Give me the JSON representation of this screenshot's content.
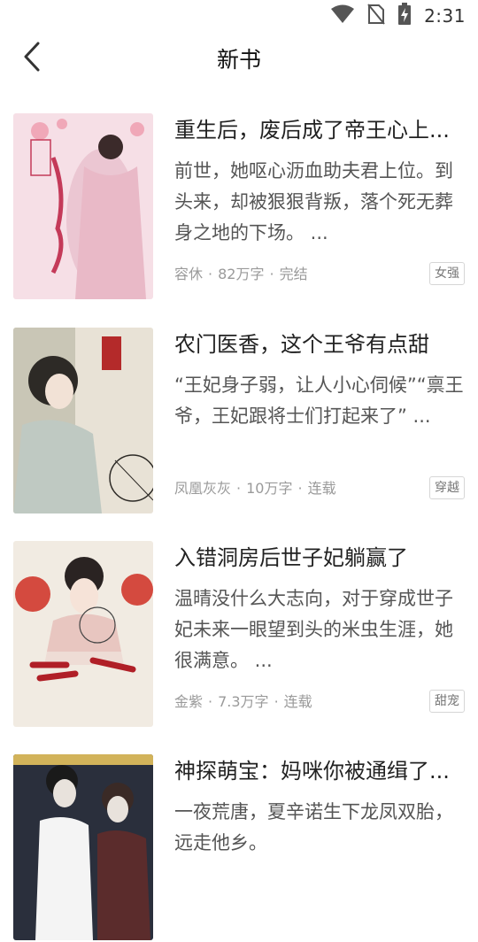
{
  "status_bar": {
    "time": "2:31",
    "icons": [
      "wifi-icon",
      "no-sim-icon",
      "battery-charging-icon"
    ]
  },
  "header": {
    "title": "新书",
    "back_icon": "chevron-left-icon"
  },
  "books": [
    {
      "title": "重生后，废后成了帝王心上...",
      "description": "前世，她呕心沥血助夫君上位。到头来，却被狠狠背叛，落个死无葬身之地的下场。 ...",
      "author": "容休",
      "words": "82万字",
      "status": "完结",
      "tag": "女强",
      "cover_colors": [
        "#f6dfe6",
        "#e9b9c7",
        "#c43a59"
      ]
    },
    {
      "title": "农门医香，这个王爷有点甜",
      "description": "“王妃身子弱，让人小心伺候”“禀王爷，王妃跟将士们打起来了” ...",
      "author": "凤凰灰灰",
      "words": "10万字",
      "status": "连载",
      "tag": "穿越",
      "cover_colors": [
        "#e8e2d6",
        "#c9c6b6",
        "#2d2a26"
      ]
    },
    {
      "title": "入错洞房后世子妃躺赢了",
      "description": "温晴没什么大志向，对于穿成世子妃未来一眼望到头的米虫生涯，她很满意。 ...",
      "author": "金紫",
      "words": "7.3万字",
      "status": "连载",
      "tag": "甜宠",
      "cover_colors": [
        "#f1ebe2",
        "#d44a3f",
        "#b01f27"
      ]
    },
    {
      "title": "神探萌宝：妈咪你被通缉了...",
      "description": "一夜荒唐，夏辛诺生下龙凤双胎，远走他乡。",
      "author": "",
      "words": "",
      "status": "",
      "tag": "",
      "cover_colors": [
        "#2a2f3c",
        "#d2b35a",
        "#e8e2dc"
      ]
    }
  ]
}
